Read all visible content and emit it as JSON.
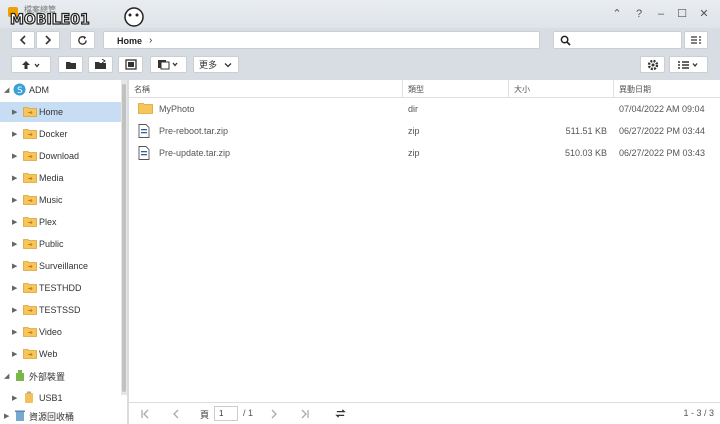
{
  "titlebar": {
    "app_title": "檔案總管",
    "watermark_text": "MOBILE01",
    "controls": [
      "⌃",
      "?",
      "–",
      "☐",
      "✕"
    ]
  },
  "nav": {
    "path": "Home",
    "path_sep": "›",
    "search_placeholder": ""
  },
  "toolbar": {
    "more_label": "更多"
  },
  "sidebar": {
    "root": "ADM",
    "folders": [
      "Home",
      "Docker",
      "Download",
      "Media",
      "Music",
      "Plex",
      "Public",
      "Surveillance",
      "TESTHDD",
      "TESTSSD",
      "Video",
      "Web"
    ],
    "external": "外部裝置",
    "usb": "USB1",
    "recycle": "資源回收桶"
  },
  "columns": {
    "name": "名稱",
    "type": "類型",
    "size": "大小",
    "modified": "異動日期"
  },
  "files": [
    {
      "name": "MyPhoto",
      "type": "dir",
      "size": "",
      "modified": "07/04/2022 AM 09:04",
      "icon": "folder-icon"
    },
    {
      "name": "Pre-reboot.tar.zip",
      "type": "zip",
      "size": "511.51 KB",
      "modified": "06/27/2022 PM 03:44",
      "icon": "file-icon"
    },
    {
      "name": "Pre-update.tar.zip",
      "type": "zip",
      "size": "510.03 KB",
      "modified": "06/27/2022 PM 03:43",
      "icon": "file-icon"
    }
  ],
  "pager": {
    "page_label": "頁",
    "page_value": "1",
    "total": "/ 1",
    "summary": "1 - 3 / 3"
  }
}
